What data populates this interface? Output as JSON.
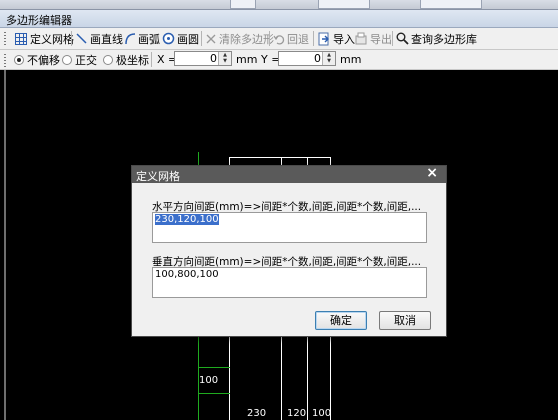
{
  "window": {
    "title": "多边形编辑器"
  },
  "toolbar": {
    "define_grid": "定义网格",
    "draw_line": "画直线",
    "draw_arc": "画弧",
    "draw_circle": "画圆",
    "clear_polygon": "清除多边形",
    "undo": "回退",
    "import": "导入",
    "export": "导出",
    "query_library": "查询多边形库"
  },
  "options": {
    "no_offset": "不偏移",
    "orthogonal": "正交",
    "polar": "极坐标",
    "selected": "不偏移",
    "x_label": "X =",
    "x_value": "0",
    "x_unit": "mm",
    "y_label": "Y =",
    "y_value": "0",
    "y_unit": "mm"
  },
  "canvas": {
    "dim_left": "100",
    "dim_bottom": [
      "230",
      "120",
      "100"
    ]
  },
  "dialog": {
    "title": "定义网格",
    "close": "×",
    "h_label": "水平方向间距(mm)=>间距*个数,间距,间距*个数,间距,...",
    "h_value": "230,120,100",
    "v_label": "垂直方向间距(mm)=>间距*个数,间距,间距*个数,间距,...",
    "v_value": "100,800,100",
    "ok": "确定",
    "cancel": "取消"
  },
  "colors": {
    "canvas_bg": "#000000",
    "grid_green": "#1faa1f",
    "selection": "#3b6fcb"
  }
}
